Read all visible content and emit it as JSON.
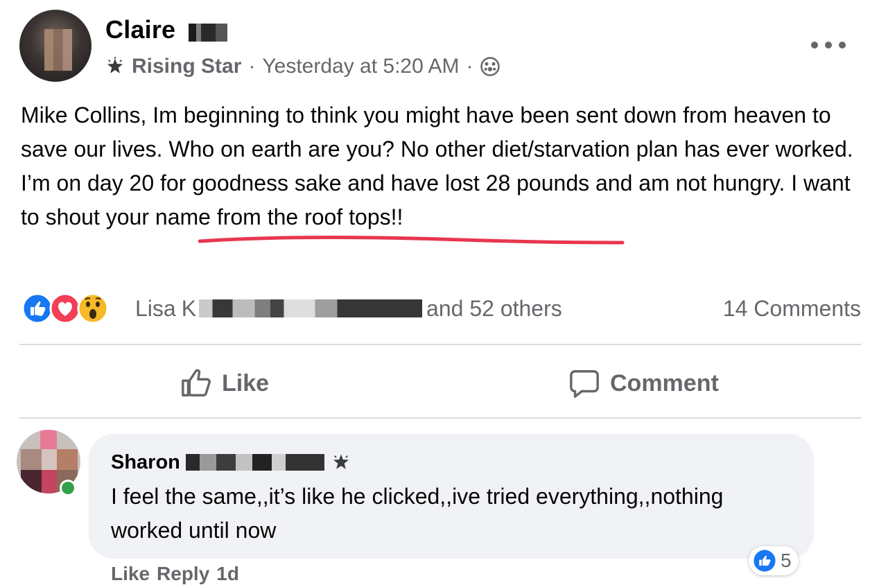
{
  "post": {
    "author_name": "Claire",
    "badge": "Rising Star",
    "separator": "·",
    "timestamp": "Yesterday at 5:20 AM",
    "separator2": "·",
    "more_icon": "more-horizontal-icon",
    "text": "Mike Collins, Im beginning to think you might have been sent down from heaven to save our lives.  Who on earth are you? No other diet/starvation plan has ever worked. I’m on day 20 for goodness sake and have lost 28 pounds and am not hungry. I want to shout your name from the roof tops!!",
    "underline_color": "#e8364f"
  },
  "reactions": {
    "icons": [
      "like-icon",
      "love-icon",
      "wow-icon"
    ],
    "first_name": "Lisa",
    "first_name_tail": "K",
    "others": "and 52 others",
    "comments_count": "14 Comments"
  },
  "actions": {
    "like_label": "Like",
    "comment_label": "Comment"
  },
  "comment": {
    "author_name": "Sharon",
    "text": "I feel the same,,it’s like he clicked,,ive tried everything,,nothing worked until now",
    "reaction_count": "5",
    "like_label": "Like",
    "reply_label": "Reply",
    "age": "1d"
  },
  "colors": {
    "secondary_text": "#65676b",
    "bubble": "#f0f2f5",
    "like_blue": "#1877f2",
    "love_red": "#f33e58",
    "wow_yellow": "#f7b928"
  }
}
